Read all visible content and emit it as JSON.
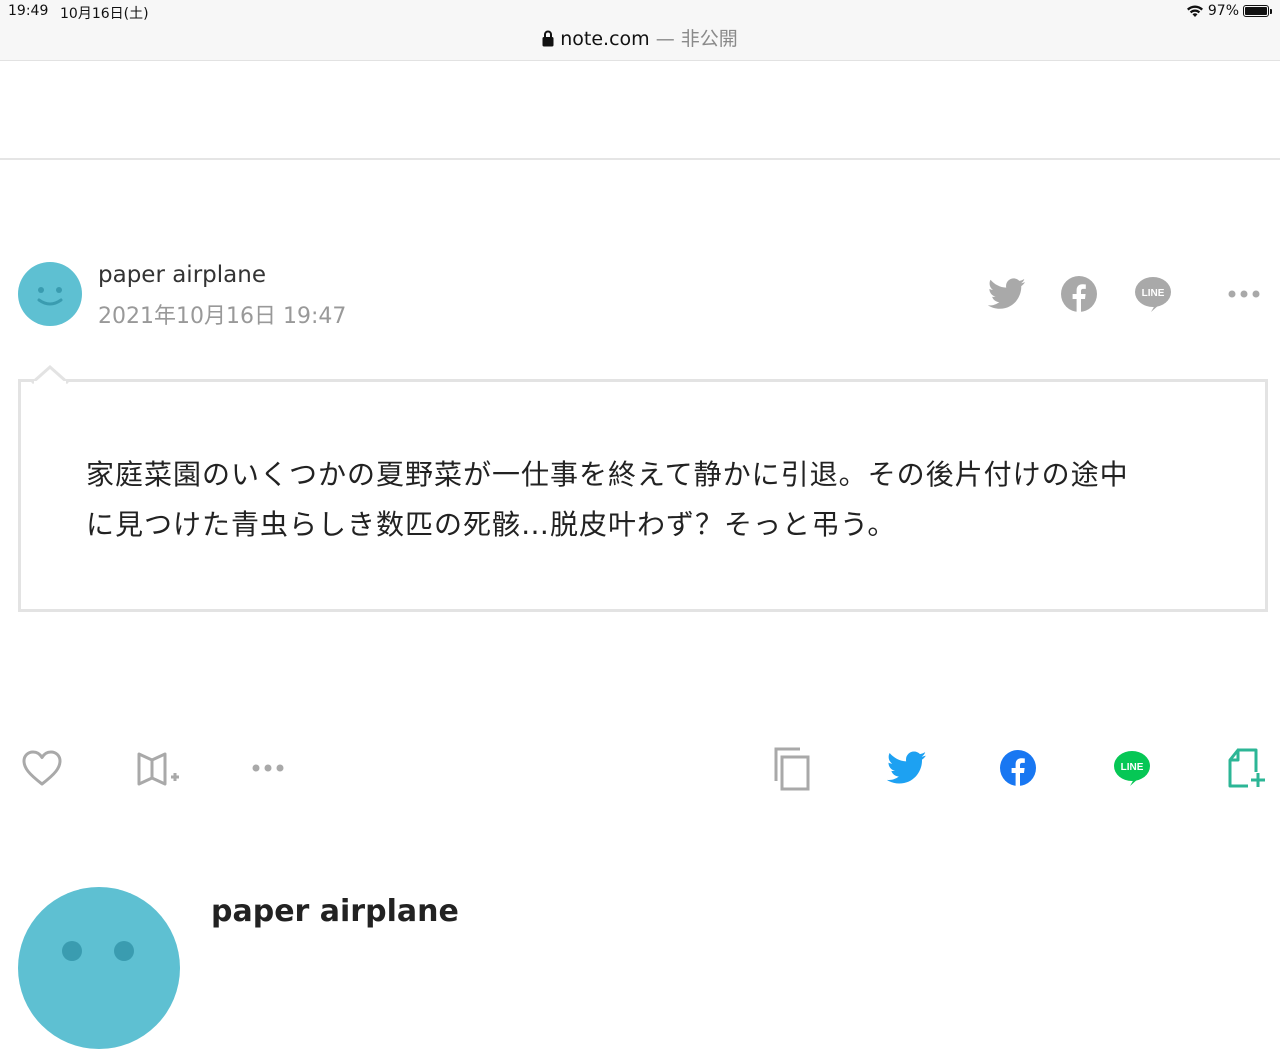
{
  "status_bar": {
    "time": "19:49",
    "date": "10月16日(土)",
    "battery": "97%",
    "icons": [
      "wifi-icon",
      "battery-icon"
    ]
  },
  "browser": {
    "domain": "note.com",
    "privacy": "— 非公開",
    "icons": [
      "lock-icon"
    ]
  },
  "post": {
    "author": "paper airplane",
    "date": "2021年10月16日 19:47",
    "text_line1": "家庭菜園のいくつかの夏野菜が一仕事を終えて静かに引退。その後片付けの途中",
    "text_line2": "に見つけた青虫らしき数匹の死骸…脱皮叶わず？そっと弔う。"
  },
  "share_top": {
    "icons": [
      "twitter-icon",
      "facebook-icon",
      "line-icon",
      "more-icon"
    ],
    "line_label": "LINE"
  },
  "actions": {
    "icons": [
      "heart-icon",
      "magazine-add-icon",
      "more-icon",
      "copy-icon",
      "twitter-icon",
      "facebook-icon",
      "line-icon",
      "note-add-icon"
    ],
    "line_label": "LINE"
  },
  "profile": {
    "name": "paper airplane"
  },
  "colors": {
    "avatar": "#5ec0d2",
    "twitter": "#1da1f2",
    "facebook": "#1877f2",
    "line": "#06c755",
    "note_green": "#2cb696",
    "gray_icon": "#a9a9a9"
  }
}
